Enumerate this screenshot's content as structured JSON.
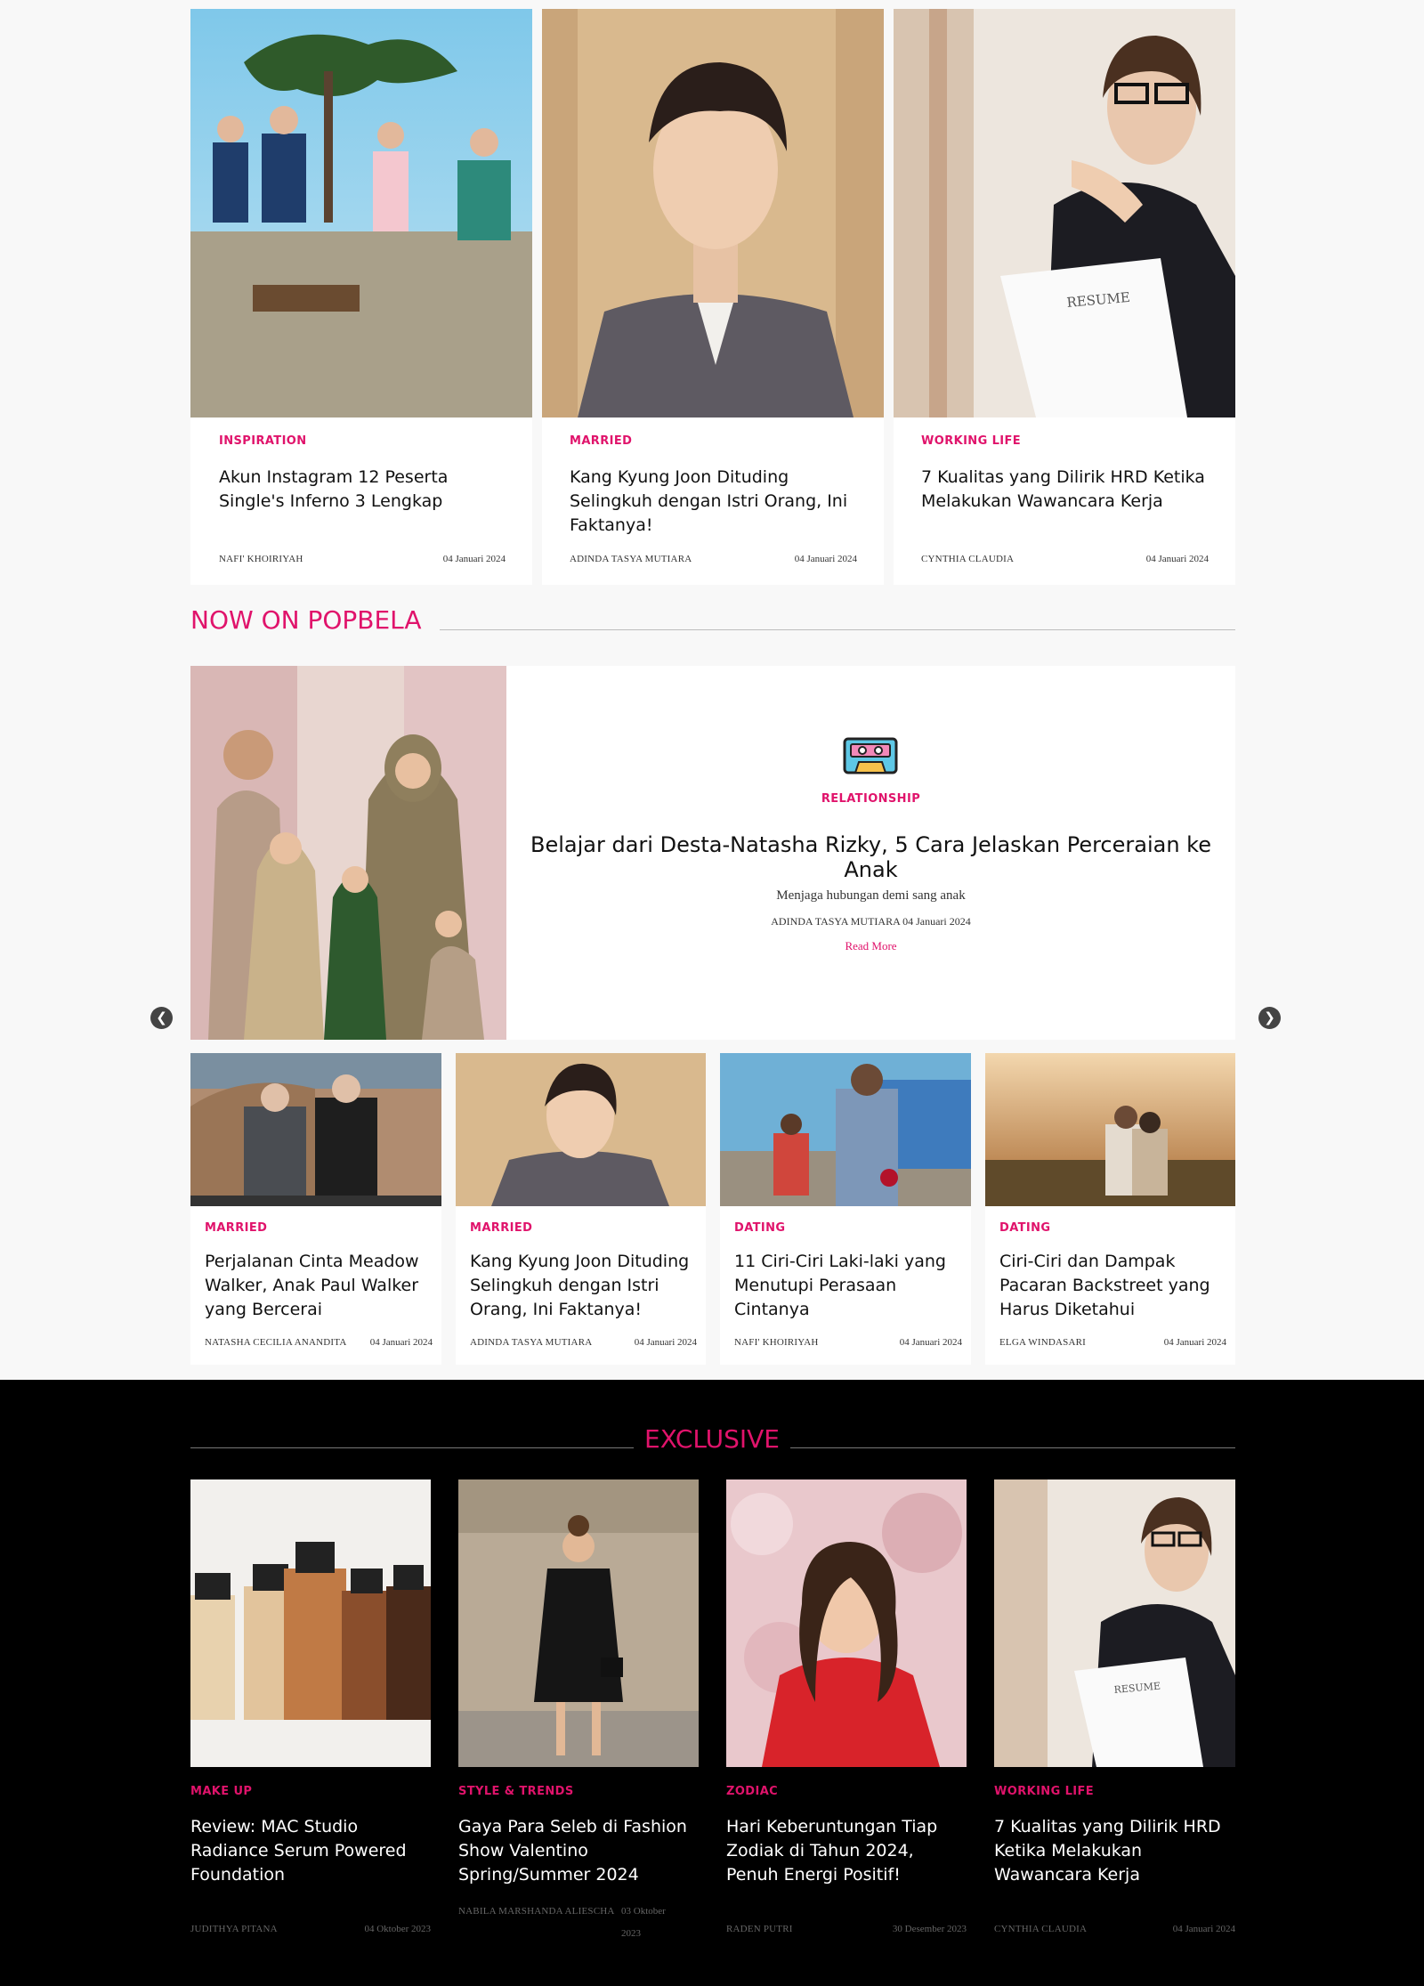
{
  "top_cards": [
    {
      "category": "INSPIRATION",
      "title": "Akun Instagram 12 Peserta Single's Inferno 3 Lengkap",
      "author": "NAFI' KHOIRIYAH",
      "date": "04 Januari 2024"
    },
    {
      "category": "MARRIED",
      "title": "Kang Kyung Joon Dituding Selingkuh dengan Istri Orang, Ini Faktanya!",
      "author": "ADINDA TASYA MUTIARA",
      "date": "04 Januari 2024"
    },
    {
      "category": "WORKING LIFE",
      "title": "7 Kualitas yang Dilirik HRD Ketika Melakukan Wawancara Kerja",
      "author": "CYNTHIA CLAUDIA",
      "date": "04 Januari 2024"
    }
  ],
  "now_on": {
    "heading": "NOW ON POPBELA",
    "featured": {
      "icon": "cassette-tape-icon",
      "category": "RELATIONSHIP",
      "title": "Belajar dari Desta-Natasha Rizky, 5 Cara Jelaskan Perceraian ke Anak",
      "summary": "Menjaga hubungan demi sang anak",
      "meta": "ADINDA TASYA MUTIARA 04 Januari 2024",
      "read_more": "Read More"
    },
    "prev_icon": "chevron-left-icon",
    "next_icon": "chevron-right-icon",
    "cards": [
      {
        "category": "MARRIED",
        "title": "Perjalanan Cinta Meadow Walker, Anak Paul Walker yang Bercerai",
        "author": "NATASHA CECILIA ANANDITA",
        "date": "04 Januari 2024"
      },
      {
        "category": "MARRIED",
        "title": "Kang Kyung Joon Dituding Selingkuh dengan Istri Orang, Ini Faktanya!",
        "author": "ADINDA TASYA MUTIARA",
        "date": "04 Januari 2024"
      },
      {
        "category": "DATING",
        "title": "11 Ciri-Ciri Laki-laki yang Menutupi Perasaan Cintanya",
        "author": "NAFI' KHOIRIYAH",
        "date": "04 Januari 2024"
      },
      {
        "category": "DATING",
        "title": "Ciri-Ciri dan Dampak Pacaran Backstreet yang Harus Diketahui",
        "author": "ELGA WINDASARI",
        "date": "04 Januari 2024"
      }
    ]
  },
  "exclusive": {
    "heading": "EXCLUSIVE",
    "cards": [
      {
        "category": "MAKE UP",
        "title": "Review: MAC Studio Radiance Serum Powered Foundation",
        "author": "JUDITHYA PITANA",
        "date": "04 Oktober 2023"
      },
      {
        "category": "STYLE & TRENDS",
        "title": "Gaya Para Seleb di Fashion Show Valentino Spring/Summer 2024",
        "author": "NABILA MARSHANDA ALIESCHA",
        "date": "03 Oktober 2023"
      },
      {
        "category": "ZODIAC",
        "title": "Hari Keberuntungan Tiap Zodiak di Tahun 2024, Penuh Energi Positif!",
        "author": "RADEN PUTRI",
        "date": "30 Desember 2023"
      },
      {
        "category": "WORKING LIFE",
        "title": "7 Kualitas yang Dilirik HRD Ketika Melakukan Wawancara Kerja",
        "author": "CYNTHIA CLAUDIA",
        "date": "04 Januari 2024"
      }
    ]
  },
  "colors": {
    "accent": "#e0136b",
    "page_bg": "#f8f8f8",
    "exclusive_bg": "#000000"
  }
}
